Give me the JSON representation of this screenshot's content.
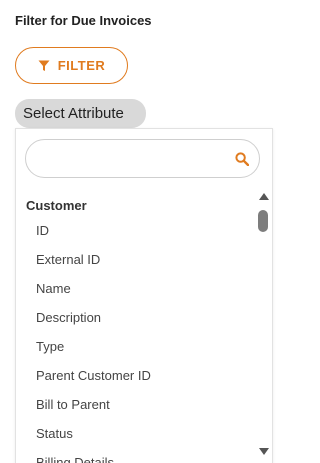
{
  "page": {
    "title": "Filter for Due Invoices"
  },
  "filter_button": {
    "label": "FILTER",
    "icon": "funnel-icon",
    "accent_color": "#e07b1f"
  },
  "select_attribute": {
    "label": "Select Attribute"
  },
  "search": {
    "value": "",
    "placeholder": "",
    "icon": "search-icon"
  },
  "dropdown": {
    "group": "Customer",
    "items": [
      "ID",
      "External ID",
      "Name",
      "Description",
      "Type",
      "Parent Customer ID",
      "Bill to Parent",
      "Status",
      "Billing Details"
    ]
  }
}
